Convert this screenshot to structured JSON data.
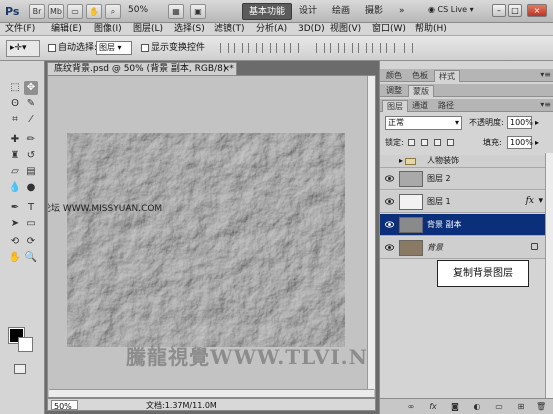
{
  "titlebar": {
    "app_logo": "Ps",
    "zoom": "50%",
    "workspaces": [
      "基本功能",
      "设计",
      "绘画",
      "摄影"
    ],
    "more": "»",
    "cs_live": "CS Live",
    "icons": [
      "file-browser-icon",
      "mini-bridge-icon",
      "screen-mode-icon",
      "hand-tool-icon",
      "zoom-tool-icon",
      "arrange-icon"
    ]
  },
  "menubar": {
    "items": [
      "文件(F)",
      "编辑(E)",
      "图像(I)",
      "图层(L)",
      "选择(S)",
      "滤镜(T)",
      "分析(A)",
      "3D(D)",
      "视图(V)",
      "窗口(W)",
      "帮助(H)"
    ]
  },
  "options": {
    "auto_select_label": "自动选择:",
    "auto_select_value": "图层",
    "show_transform_label": "显示变换控件"
  },
  "document": {
    "tab_title": "底纹背景.psd @ 50% (背景 副本, RGB/8) *",
    "close_symbol": "×",
    "zoom": "50%",
    "doc_info": "文档:1.37M/11.0M",
    "watermark_mid": "思缘设计论坛  WWW.MISSYUAN.COM",
    "watermark_bottom": "騰龍視覺WWW.TLVI.NET"
  },
  "panels": {
    "top_tabs": [
      "颜色",
      "色板",
      "样式"
    ],
    "mid_tabs": [
      "调整",
      "蒙版"
    ],
    "layer_tabs": [
      "图层",
      "通道",
      "路径"
    ],
    "blend_mode": "正常",
    "opacity_label": "不透明度:",
    "opacity_value": "100%",
    "lock_label": "锁定:",
    "fill_label": "填充:",
    "fill_value": "100%",
    "group_name": "人物装饰",
    "layers": [
      {
        "name": "图层 2",
        "fx": "",
        "locked": false
      },
      {
        "name": "图层 1",
        "fx": "fx",
        "locked": false
      },
      {
        "name": "背景 副本",
        "fx": "",
        "locked": false
      },
      {
        "name": "背景",
        "fx": "",
        "locked": true
      }
    ],
    "callout": "复制背景图层",
    "footer_icons": [
      "link-icon",
      "fx-icon",
      "mask-icon",
      "adjustment-icon",
      "group-icon",
      "new-layer-icon",
      "trash-icon"
    ]
  },
  "colors": {
    "selected_layer": "#0b2f7a",
    "active_workspace": "#5b5b5b"
  }
}
